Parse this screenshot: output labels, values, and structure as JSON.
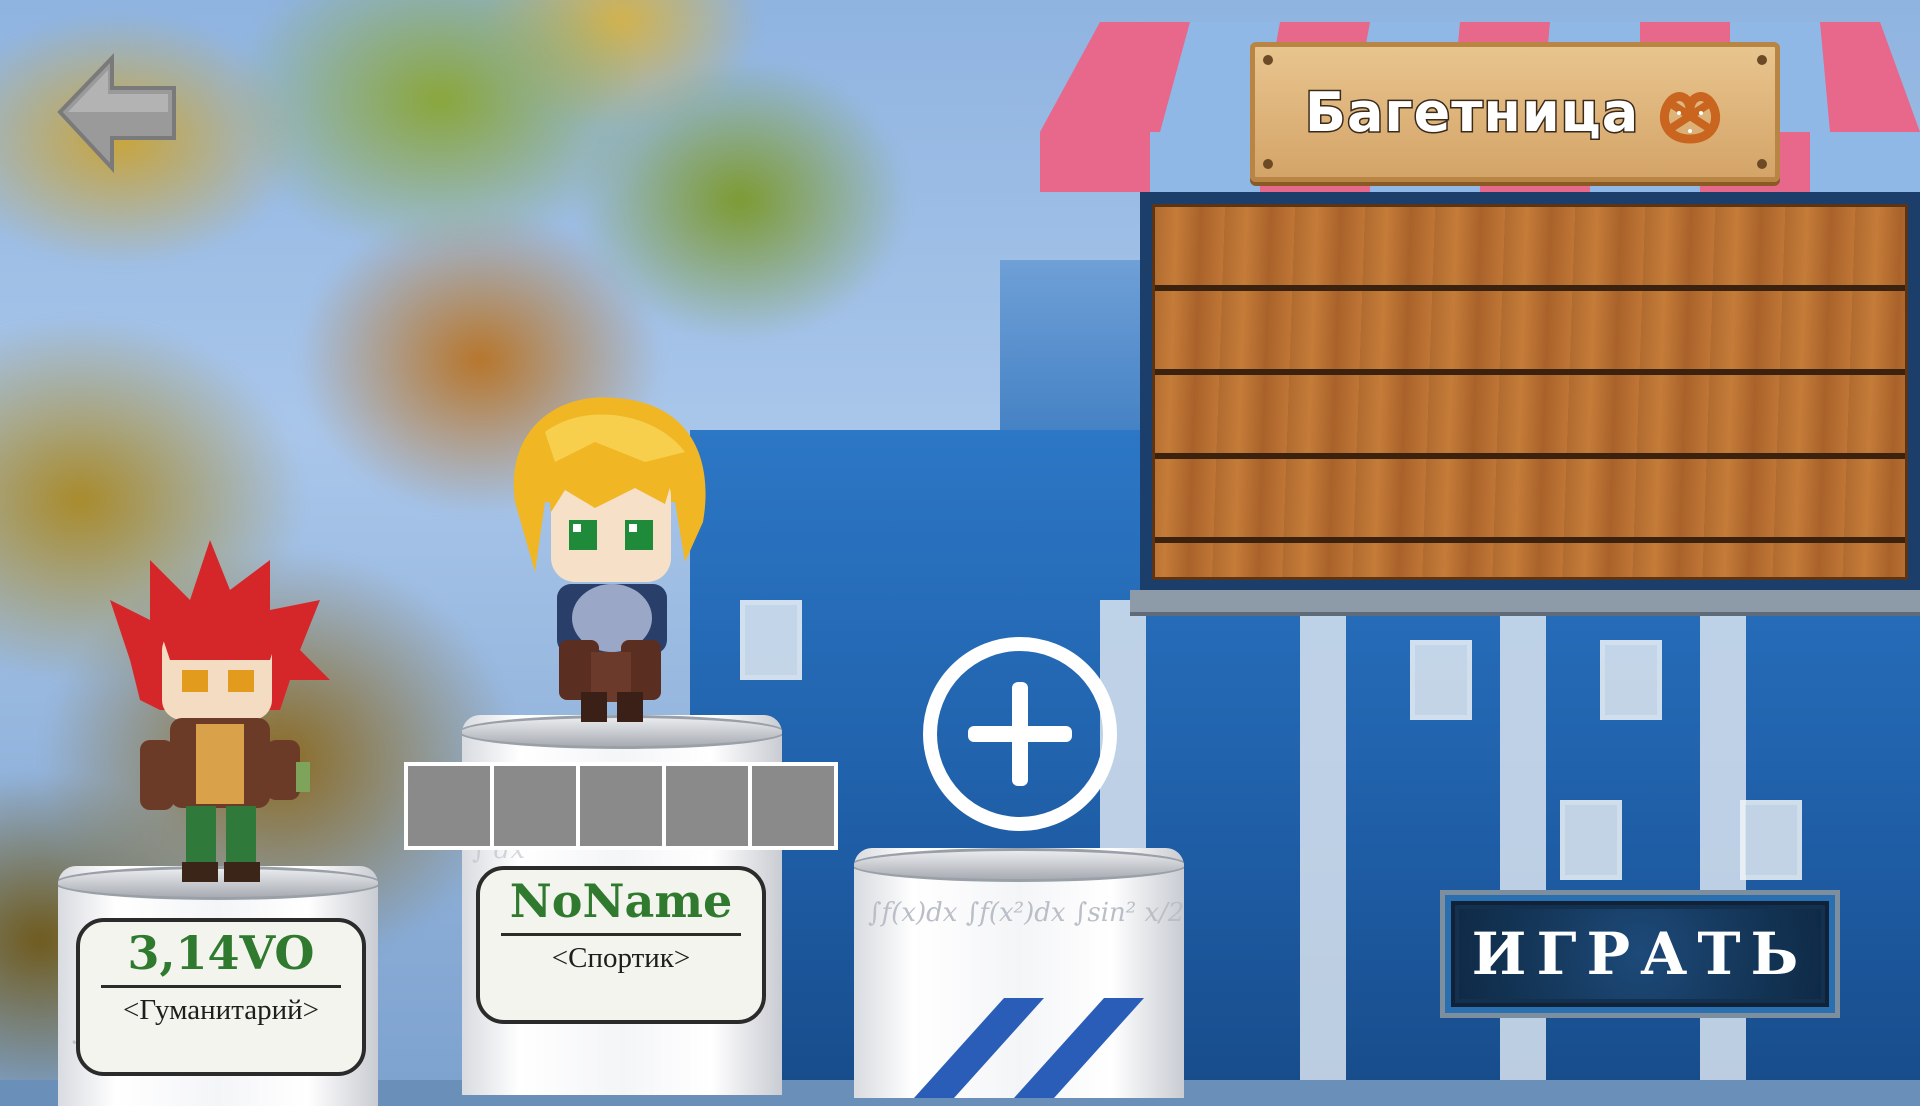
{
  "shop": {
    "title": "Багетница",
    "icon": "pretzel-icon"
  },
  "characters": [
    {
      "name": "3,14VO",
      "class": "<Гуманитарий>",
      "hair": "#d5272a"
    },
    {
      "name": "NoName",
      "class": "<Спортик>",
      "hair": "#f0b624"
    }
  ],
  "slots": {
    "count": 5
  },
  "buttons": {
    "play": "ИГРАТЬ",
    "back": "back-arrow-icon",
    "add": "add-character-icon"
  },
  "colors": {
    "name_green": "#2f7a2e",
    "awning_pink": "#e7688a",
    "awning_blue": "#8fb8e6",
    "play_bg": "#14304f"
  }
}
